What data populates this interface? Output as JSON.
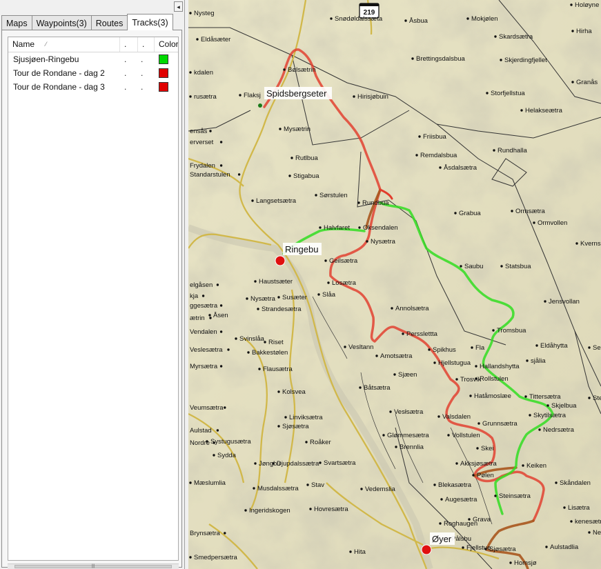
{
  "sidebar": {
    "collapse_icon": "◂",
    "tabs": [
      {
        "label": "Maps"
      },
      {
        "label": "Waypoints(3)"
      },
      {
        "label": "Routes"
      },
      {
        "label": "Tracks(3)"
      }
    ],
    "columns": {
      "name": "Name",
      "sort_icon": "⁄",
      "c2": ".",
      "c3": ".",
      "color": "Color"
    },
    "tracks": [
      {
        "name": "Sjusjøen-Ringebu",
        "d1": ".",
        "d2": ".",
        "color": "#00d800"
      },
      {
        "name": "Tour de Rondane - dag 2",
        "d1": ".",
        "d2": ".",
        "color": "#e00000"
      },
      {
        "name": "Tour de Rondane - dag 3",
        "d1": ".",
        "d2": ".",
        "color": "#e00000"
      }
    ],
    "scroll_grip": "|||"
  },
  "map": {
    "road_shield": "219",
    "places_big": [
      {
        "name": "Spidsbergseter"
      },
      {
        "name": "Ringebu"
      },
      {
        "name": "Øyer"
      }
    ],
    "places": [
      "Nysteg",
      "Snødøldalssæta",
      "Åsbua",
      "Mokjølen",
      "Holøyne",
      "Eldåsæter",
      "Skardsætra",
      "Hirha",
      "Brettingsdalsbua",
      "Skjerdingfjellet",
      "Bølsætrin",
      "kdalen",
      "Granås",
      "Hirisjøbuin",
      "Storfjellstua",
      "rusætra",
      "Flaksj",
      "Helakseætra",
      "Mysætrin",
      "ensås",
      "erverset",
      "Friisbua",
      "Rundhalla",
      "Rutlbua",
      "Remdalsbua",
      "Frydalen",
      "Standarstulen",
      "Åsdalsætra",
      "Stigabua",
      "Langsetsætra",
      "Sørstulen",
      "Rundbua",
      "Grabua",
      "Ormsætra",
      "Halvfaret",
      "Oksendalen",
      "Ormvollen",
      "Nysætra",
      "Kvernskje",
      "Geilsætra",
      "Saubu",
      "Statsbua",
      "Haustsæter",
      "Losætra",
      "elgåsen",
      "kja",
      "Susæter",
      "Slåa",
      "Jensvollan",
      "Nysætra",
      "ggesætra",
      "Strandesætra",
      "Annolsætra",
      "Åsen",
      "ætrin",
      "Tromsbua",
      "Vendalen",
      "Svinslåa",
      "Persslettta",
      "Eldåhytta",
      "Segalstadsætra",
      "Riset",
      "Vesltann",
      "Spikhus",
      "Fla",
      "Veslesætra",
      "Bakkestølen",
      "Amotsætra",
      "Hjellstugua",
      "Hallandshytta",
      "sjålia",
      "Myrsætra",
      "Flausætra",
      "Sjæen",
      "Trosvik",
      "Rollstulen",
      "Båtsætra",
      "Tittersætra",
      "Steinh",
      "Hatåmoslæe",
      "Skjelbua",
      "Veumsætra",
      "Kolsvea",
      "Vesłsætra",
      "Skytilsætra",
      "Linviksætra",
      "Valsdalen",
      "Sjøsætra",
      "Grunnsætra",
      "Nedrsætra",
      "Glømmesætra",
      "Vollstulen",
      "Roåker",
      "Brennlia",
      "Aulstad",
      "Nordre",
      "Systugusætra",
      "Sydda",
      "Skei",
      "Jøngbu",
      "Djupdalssætra",
      "Svartsætra",
      "Akksjøsætra",
      "Keiken",
      "Pølen",
      "Blekasætra",
      "Skåndalen",
      "Mæslumlia",
      "Musdalssætra",
      "Stav",
      "Vedemslia",
      "Steinsætra",
      "Augesætra",
      "Lisætra",
      "Ingeridskogen",
      "Hovresætra",
      "Roghaugen",
      "Grava",
      "kenesætra",
      "Brynsætra",
      "Pålsbu",
      "Nerm",
      "Fjellstue",
      "Sjøsætra",
      "Aulstadlia",
      "Smedpersætra",
      "Hita",
      "Homsjø"
    ]
  }
}
